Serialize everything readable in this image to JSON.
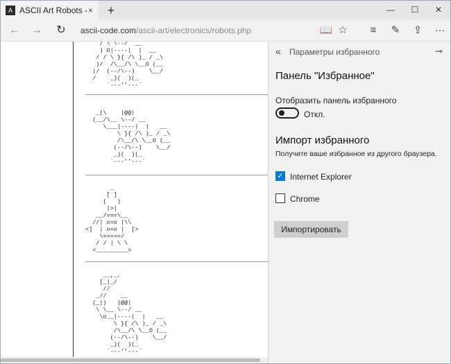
{
  "tab": {
    "favicon": "A",
    "title": "ASCII Art Robots - ascii",
    "close": "×",
    "new_tab": "+"
  },
  "window_controls": {
    "minimize": "—",
    "maximize": "☐",
    "close": "✕"
  },
  "nav": {
    "back": "←",
    "forward": "→",
    "refresh": "↻"
  },
  "address": {
    "host": "ascii-code.com",
    "path": "/ascii-art/electronics/robots.php"
  },
  "toolbar_icons": [
    "reading-view-icon",
    "star-icon",
    "hub-icon",
    "web-note-icon",
    "share-icon",
    "more-icon"
  ],
  "toolbar_glyphs": {
    "reading": "📖",
    "star": "☆",
    "hub": "≡",
    "note": "✎",
    "share": "⇪",
    "more": "···"
  },
  "page": {
    "art1": "    / \\ \\--/  __\n    ) O|----|  |  __\n   / / \\ }{ /\\ )_ / _\\\n   )/  /\\__/\\ \\__O (__\n  |/  (--/\\--)    \\__/\n  /    _)(  )(_\n      `---''---`",
    "art2": "   _(\\    |@@|\n  (__/\\__ \\--/ __\n     \\___|----|  |   __\n         \\ }{ /\\ )_ / _\\\n         /\\__/\\ \\__O (__\n        (--/\\--)    \\__/\n        _)(  )(_\n       `---''---`",
    "art3": "       _\n      [ ]\n     (   )\n      |>|\n   __/===\\__\n  //| o=o |\\\\\n<]  | o=o |  [>\n    \\=====/\n   / / | \\ \\\n  <_________>",
    "art4": "     __,_,\n    [_|_/\n     //\n   _//    __\n  (_|)   |@@|\n   \\ \\__ \\--/ __\n    \\o__|----|  |   __\n        \\ }{ /\\ )_ / _\\\n        /\\__/\\ \\__O (__\n       (--/\\--)    \\__/\n       _)(  )(_\n      `---''---`"
  },
  "pane": {
    "back": "«",
    "title": "Параметры избранного",
    "pin": "⊸",
    "panel_heading": "Панель \"Избранное\"",
    "show_label": "Отобразить панель избранного",
    "toggle_state": "Откл.",
    "import_heading": "Импорт избранного",
    "import_desc": "Получите ваше избранное из другого браузера.",
    "browsers": [
      {
        "label": "Internet Explorer",
        "checked": true
      },
      {
        "label": "Chrome",
        "checked": false
      }
    ],
    "check_glyph": "✓",
    "import_button": "Импортировать"
  }
}
